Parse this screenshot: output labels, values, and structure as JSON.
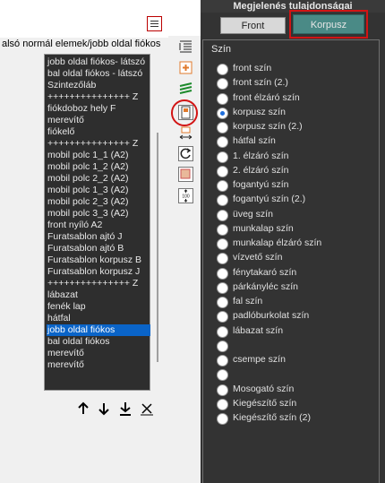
{
  "window_title": "Megjelenés tulajdonságai",
  "tabs": {
    "front": "Front",
    "korpusz": "Korpusz"
  },
  "left": {
    "heading": "alsó normál elemek/jobb oldal fiókos",
    "items": [
      "jobb oldal fiókos- látszó",
      "bal oldal fiókos - látszó",
      "Szintezőláb",
      "+++++++++++++++ Z",
      "fiókdoboz hely F",
      "merevítő",
      "fiókelő",
      "+++++++++++++++ Z",
      "mobil polc 1_1 (A2)",
      "mobil polc 1_2 (A2)",
      "mobil polc 2_2 (A2)",
      "mobil polc 1_3 (A2)",
      "mobil polc 2_3 (A2)",
      "mobil polc 3_3 (A2)",
      "front nyíló A2",
      "Furatsablon ajtó J",
      "Furatsablon ajtó B",
      "Furatsablon korpusz B",
      "Furatsablon korpusz J",
      "+++++++++++++++ Z",
      "lábazat",
      "fenék lap",
      "hátfal",
      "jobb oldal fiókos",
      "bal oldal fiókos",
      "merevítő",
      "merevítő"
    ],
    "selected_index": 23,
    "actions": [
      "move-up-icon",
      "move-down-icon",
      "move-bottom-icon",
      "delete-icon"
    ]
  },
  "toolbar": [
    "list-icon",
    "add-icon",
    "layers-icon",
    "panel-icon",
    "resize-icon",
    "rotate-icon",
    "color-icon",
    "scale-icon"
  ],
  "right": {
    "group_label": "Szín",
    "options": [
      "front szín",
      "front szín (2.)",
      "front élzáró szín",
      "korpusz szín",
      "korpusz szín (2.)",
      "hátfal szín",
      "1. élzáró szín",
      "2. élzáró szín",
      "fogantyú szín",
      "fogantyú szín (2.)",
      "üveg szín",
      "munkalap szín",
      "munkalap élzáró szín",
      "vízvető szín",
      "fénytakaró szín",
      "párkányléc szín",
      "fal szín",
      "padlóburkolat szín",
      "lábazat szín",
      "",
      "csempe szín",
      "",
      "Mosogató szín",
      "Kiegészítő szín",
      "Kiegészítő szín (2)"
    ],
    "selected_index": 3
  },
  "colors": {
    "accent_tab": "#4a8a86",
    "highlight_red": "#d21414",
    "selection": "#0a64c8"
  }
}
